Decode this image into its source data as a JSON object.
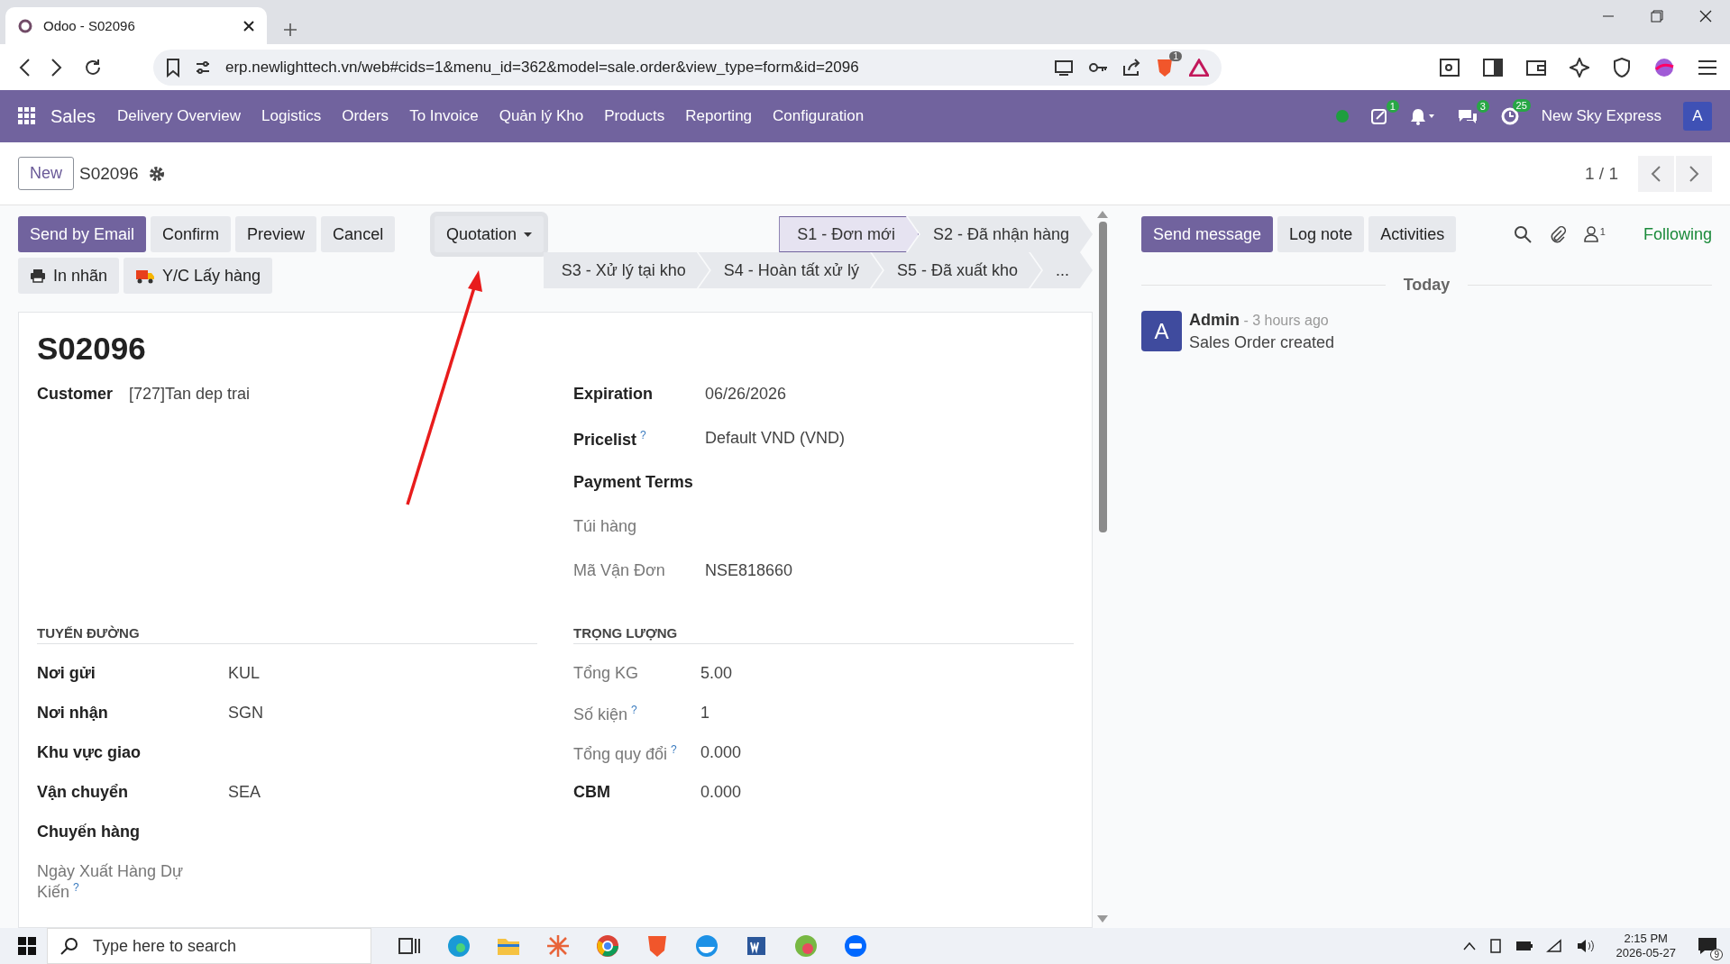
{
  "browser": {
    "tab_title": "Odoo - S02096",
    "url": "erp.newlighttech.vn/web#cids=1&menu_id=362&model=sale.order&view_type=form&id=2096",
    "shield_badge": "1"
  },
  "navbar": {
    "app_name": "Sales",
    "menu": [
      "Delivery Overview",
      "Logistics",
      "Orders",
      "To Invoice",
      "Quản lý Kho",
      "Products",
      "Reporting",
      "Configuration"
    ],
    "systray": [
      {
        "kind": "presence"
      },
      {
        "kind": "activity",
        "badge": "1"
      },
      {
        "kind": "bell"
      },
      {
        "kind": "chat",
        "badge": "3"
      },
      {
        "kind": "timer",
        "badge": "25"
      }
    ],
    "company": "New Sky Express",
    "user_initial": "A"
  },
  "control_panel": {
    "new_button": "New",
    "record_name": "S02096",
    "pager": "1 / 1"
  },
  "actions": [
    {
      "label": "Send by Email",
      "kind": "primary"
    },
    {
      "label": "Confirm",
      "kind": "secondary"
    },
    {
      "label": "Preview",
      "kind": "secondary"
    },
    {
      "label": "Cancel",
      "kind": "secondary"
    }
  ],
  "extra_actions": [
    {
      "label": "In nhãn",
      "kind": "printer"
    },
    {
      "label": "Y/C Lấy hàng",
      "kind": "truck"
    }
  ],
  "status_dropdown": {
    "label": "Quotation"
  },
  "statusbar": {
    "stages": [
      {
        "label": "S1 - Đơn mới",
        "selected": true
      },
      {
        "label": "S2 - Đã nhận hàng",
        "selected": false
      },
      {
        "label": "S3 - Xử lý tại kho",
        "selected": false
      },
      {
        "label": "S4 - Hoàn tất xử lý",
        "selected": false
      },
      {
        "label": "S5 - Đã xuất kho",
        "selected": false
      },
      {
        "label": "...",
        "selected": false
      }
    ]
  },
  "form": {
    "title": "S02096",
    "main_left": [
      {
        "label": "Customer",
        "value": "[727]Tan dep trai",
        "readonly": false
      }
    ],
    "main_right": [
      {
        "label": "Expiration",
        "value": "06/26/2026",
        "readonly": false
      },
      {
        "label": "Pricelist",
        "help": "?",
        "value": "Default VND (VND)",
        "readonly": false
      },
      {
        "label": "Payment Terms",
        "readonly": false
      },
      {
        "label": "Túi hàng",
        "readonly": true
      },
      {
        "label": "Mã Vận Đơn",
        "value": "NSE818660",
        "readonly": true
      }
    ],
    "groups": [
      {
        "title": "TUYẾN ĐƯỜNG",
        "fields": [
          {
            "label": "Nơi gửi",
            "value": "KUL",
            "readonly": false
          },
          {
            "label": "Nơi nhận",
            "value": "SGN",
            "readonly": false
          },
          {
            "label": "Khu vực giao",
            "readonly": false
          },
          {
            "label": "Vận chuyển",
            "value": "SEA",
            "readonly": false
          },
          {
            "label": "Chuyến hàng",
            "readonly": false
          },
          {
            "label": "Ngày Xuất Hàng Dự Kiến",
            "help": "?",
            "readonly": true
          }
        ]
      },
      {
        "title": "TRỌNG LƯỢNG",
        "fields": [
          {
            "label": "Tổng KG",
            "value": "5.00",
            "readonly": true
          },
          {
            "label": "Số kiện",
            "help": "?",
            "value": "1",
            "readonly": true
          },
          {
            "label": "Tổng quy đổi",
            "help": "?",
            "value": "0.000",
            "readonly": true
          },
          {
            "label": "CBM",
            "value": "0.000",
            "readonly": false
          }
        ]
      }
    ]
  },
  "chatter": {
    "buttons": [
      {
        "label": "Send message",
        "kind": "primary"
      },
      {
        "label": "Log note",
        "kind": "secondary"
      },
      {
        "label": "Activities",
        "kind": "secondary"
      }
    ],
    "follower_count": "1",
    "follow_label": "Following",
    "date_separator": "Today",
    "messages": [
      {
        "initial": "A",
        "author": "Admin",
        "time": "- 3 hours ago",
        "body": "Sales Order created"
      }
    ]
  },
  "taskbar": {
    "search_placeholder": "Type here to search",
    "time": "2:15 PM",
    "date": "2026-05-27",
    "notification_count": "9"
  }
}
